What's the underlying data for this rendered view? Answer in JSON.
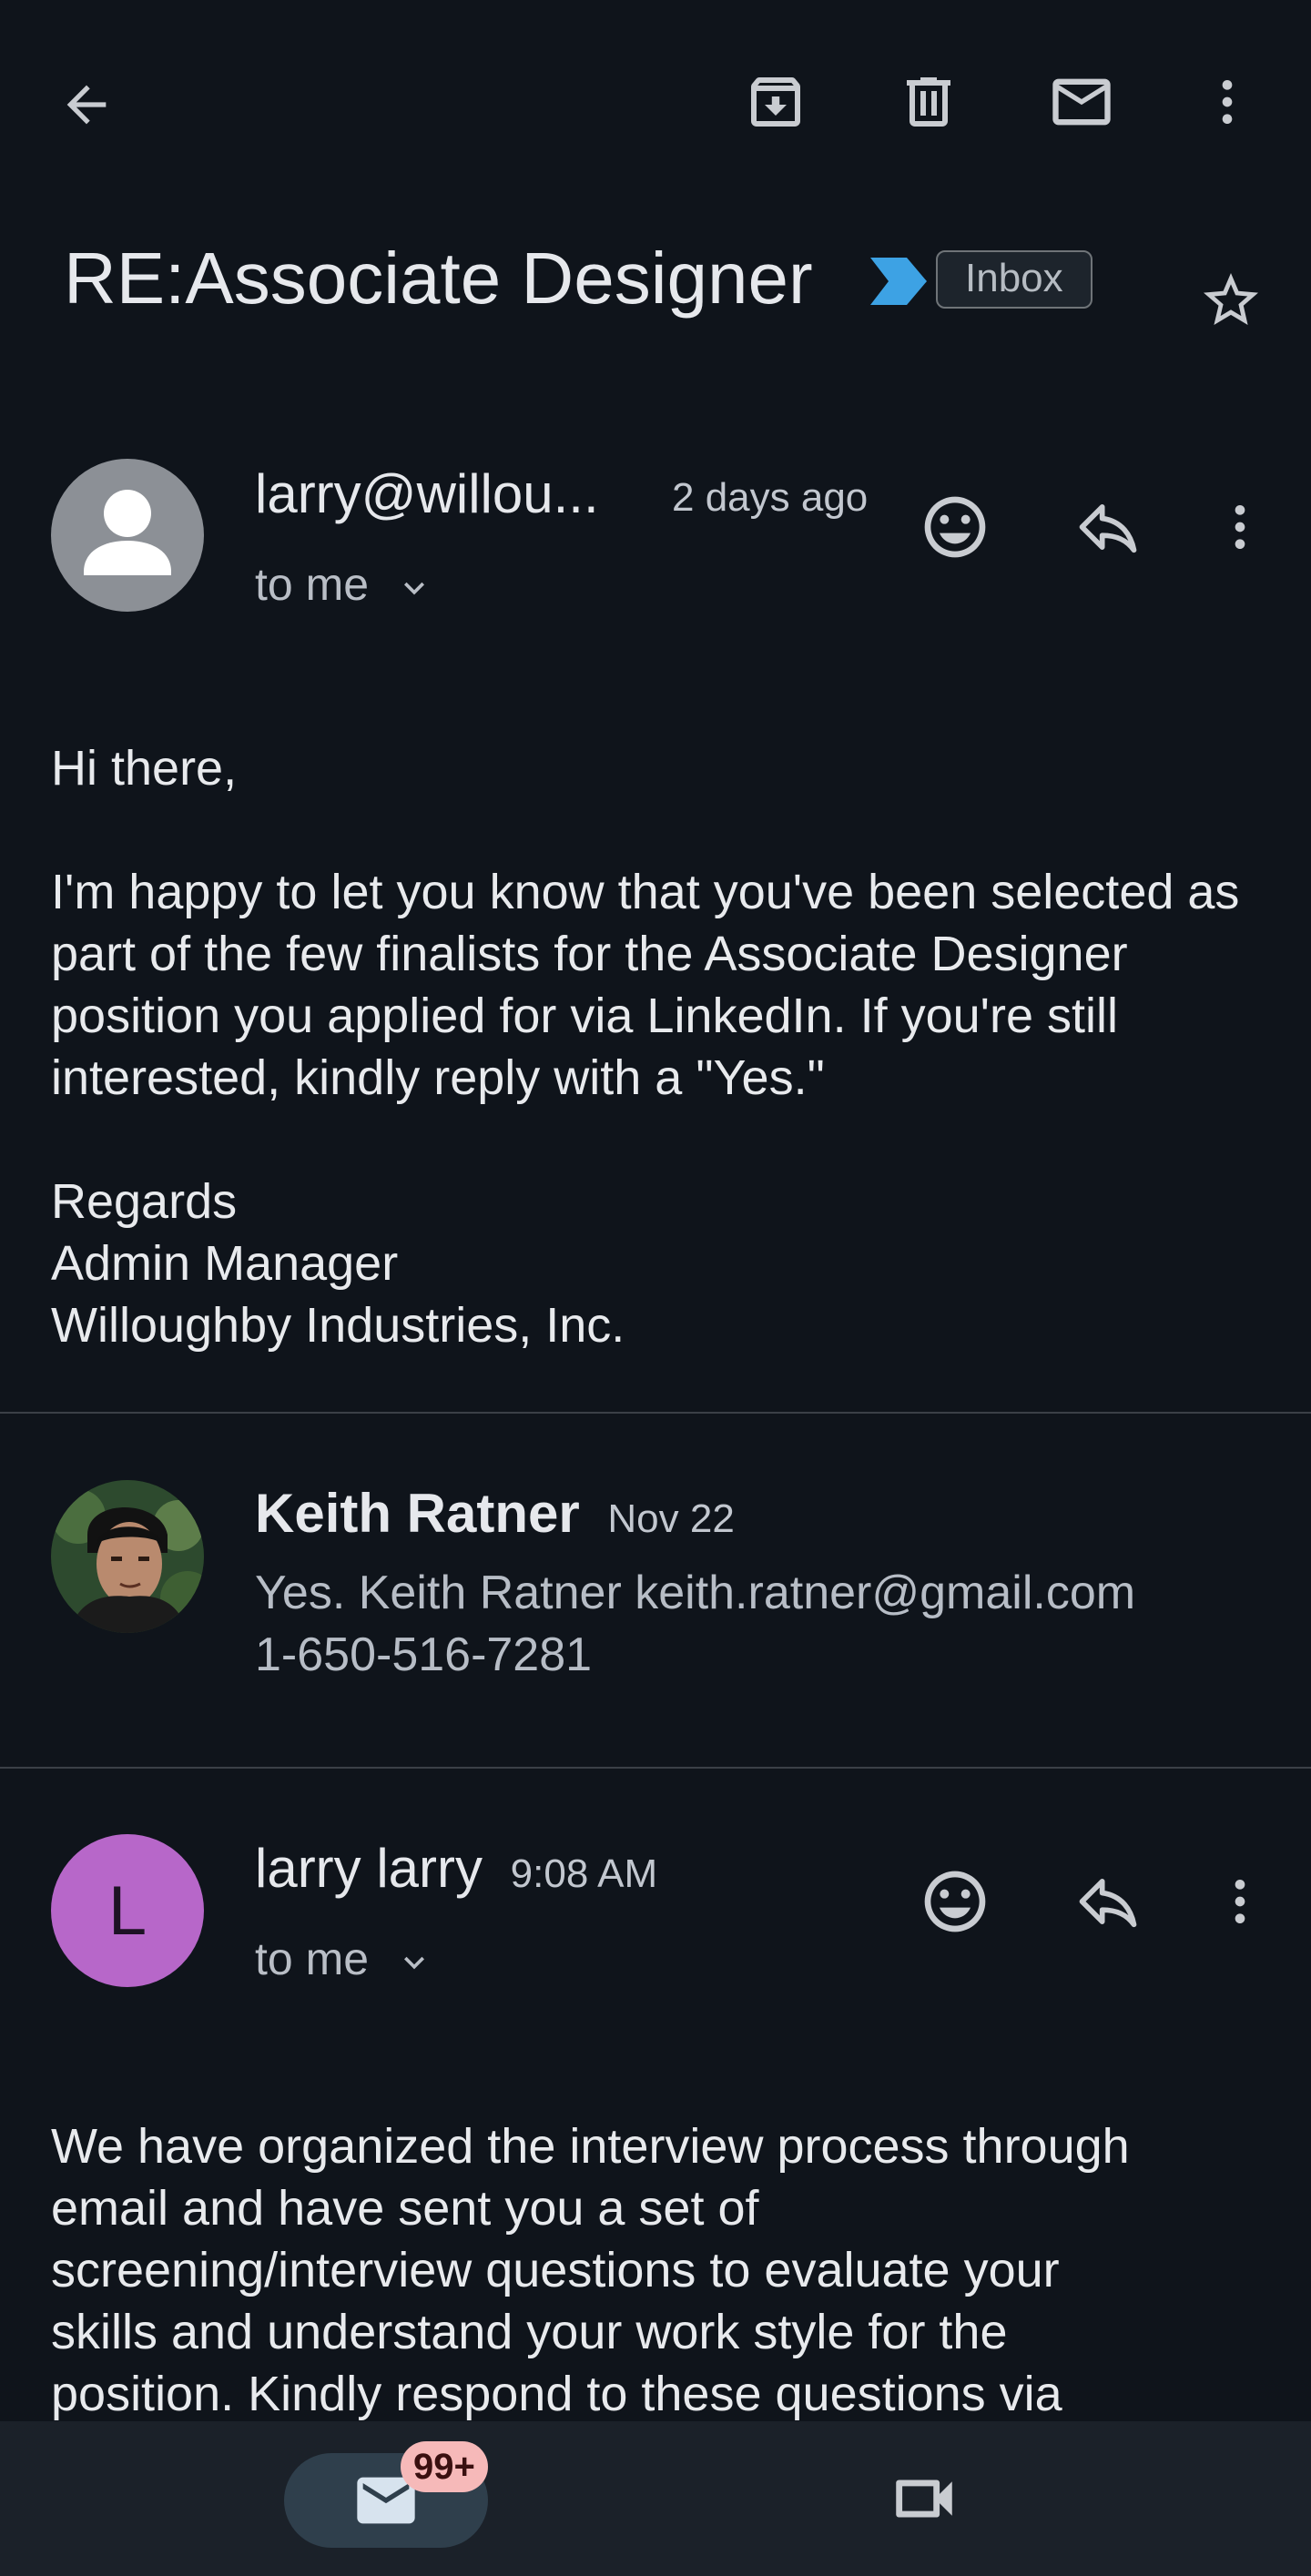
{
  "toolbar": {
    "back_icon": "arrow-left-icon",
    "archive_icon": "archive-icon",
    "delete_icon": "trash-icon",
    "mark_unread_icon": "mail-icon",
    "more_icon": "more-vert-icon"
  },
  "subject": {
    "title": "RE:Associate Designer",
    "label": "Inbox",
    "important_icon": "important-marker-icon",
    "star_icon": "star-outline-icon",
    "important_color": "#3da2e4"
  },
  "messages": [
    {
      "sender": "larry@willou...",
      "time": "2 days ago",
      "recipient": "to me",
      "avatar_color": "#8c9096",
      "body": [
        "Hi there,",
        "I'm happy to let you know that you've been selected as part of the few finalists for the Associate Designer position you applied for via LinkedIn. If you're still interested, kindly reply with a \"Yes.\"",
        "Regards",
        "Admin Manager",
        "Willoughby Industries, Inc."
      ]
    },
    {
      "sender": "Keith Ratner",
      "time": "Nov 22",
      "preview_line1": "Yes. Keith Ratner keith.ratner@gmail.com",
      "preview_line2": "1-650-516-7281"
    },
    {
      "sender": "larry larry",
      "time": "9:08 AM",
      "recipient": "to me",
      "avatar_letter": "L",
      "avatar_color": "#b767c9",
      "body_lines": [
        "We have organized the interview process through",
        "email and have sent you a set of",
        "screening/interview questions to evaluate your",
        "skills and understand your work style for the",
        "position. Kindly respond to these questions via"
      ]
    }
  ],
  "bottom_nav": {
    "mail_icon": "mail-icon",
    "mail_badge": "99+",
    "meet_icon": "video-camera-icon"
  }
}
